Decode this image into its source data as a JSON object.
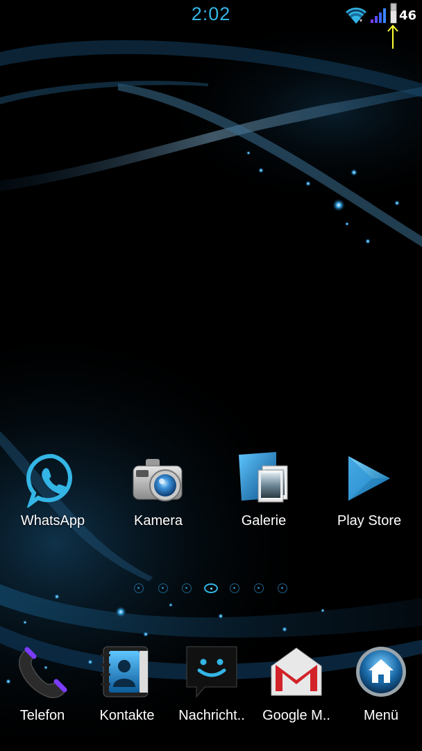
{
  "status_bar": {
    "time": "2:02",
    "battery_level": "46",
    "icons": [
      "wifi-icon",
      "signal-icon",
      "battery-icon",
      "arrow-up-icon"
    ]
  },
  "home_apps": [
    {
      "label": "WhatsApp",
      "icon": "whatsapp-icon"
    },
    {
      "label": "Kamera",
      "icon": "camera-icon"
    },
    {
      "label": "Galerie",
      "icon": "gallery-icon"
    },
    {
      "label": "Play Store",
      "icon": "play-store-icon"
    }
  ],
  "page_indicator": {
    "pages": 7,
    "current_page": 4
  },
  "dock": [
    {
      "label": "Telefon",
      "icon": "phone-icon"
    },
    {
      "label": "Kontakte",
      "icon": "contacts-icon"
    },
    {
      "label": "Nachricht..",
      "icon": "messaging-icon"
    },
    {
      "label": "Google M..",
      "icon": "gmail-icon"
    },
    {
      "label": "Menü",
      "icon": "home-menu-icon"
    }
  ],
  "colors": {
    "accent": "#33b5e5",
    "background": "#000000"
  }
}
